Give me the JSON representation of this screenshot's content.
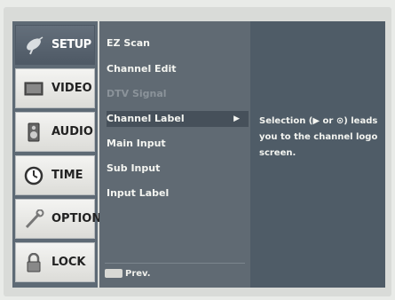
{
  "sidebar": {
    "tabs": [
      {
        "label": "SETUP",
        "icon": "satellite-dish-icon",
        "active": true
      },
      {
        "label": "VIDEO",
        "icon": "tv-icon",
        "active": false
      },
      {
        "label": "AUDIO",
        "icon": "speaker-icon",
        "active": false
      },
      {
        "label": "TIME",
        "icon": "clock-icon",
        "active": false
      },
      {
        "label": "OPTION",
        "icon": "wrench-icon",
        "active": false
      },
      {
        "label": "LOCK",
        "icon": "padlock-icon",
        "active": false
      }
    ]
  },
  "menu": {
    "items": [
      {
        "label": "EZ Scan",
        "state": "normal"
      },
      {
        "label": "Channel Edit",
        "state": "normal"
      },
      {
        "label": "DTV Signal",
        "state": "disabled"
      },
      {
        "label": "Channel Label",
        "state": "selected"
      },
      {
        "label": "Main Input",
        "state": "normal"
      },
      {
        "label": "Sub Input",
        "state": "normal"
      },
      {
        "label": "Input Label",
        "state": "normal"
      }
    ],
    "footer_label": "Prev."
  },
  "description": {
    "text": "Selection (▶ or ⊙) leads you to the channel logo screen."
  }
}
